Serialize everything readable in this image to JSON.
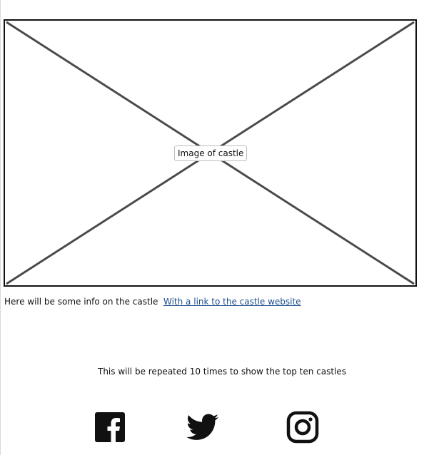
{
  "image": {
    "caption": "Image of castle"
  },
  "info": {
    "text": "Here will be some info on the castle",
    "link_label": "With a link to the castle website"
  },
  "note": "This will be repeated 10 times to show the top ten castles",
  "social": [
    {
      "name": "facebook",
      "icon": "facebook-icon"
    },
    {
      "name": "twitter",
      "icon": "twitter-icon"
    },
    {
      "name": "instagram",
      "icon": "instagram-icon"
    }
  ],
  "colors": {
    "link": "#1f4e8c",
    "outline": "#111111",
    "placeholder_lines": "#4a4a4a"
  }
}
